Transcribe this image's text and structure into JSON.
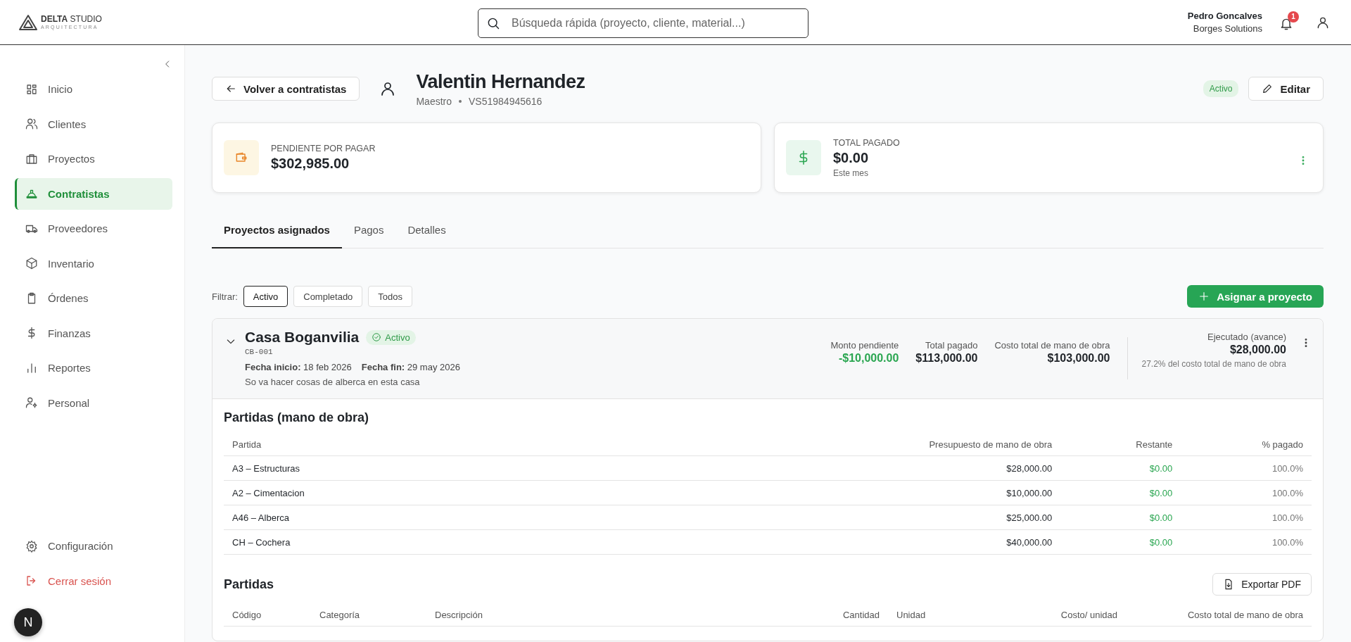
{
  "header": {
    "brand_bold": "DELTA",
    "brand_light": "STUDIO",
    "tagline": "ARQUITECTURA",
    "search": {
      "placeholder": "Búsqueda rápida (proyecto, cliente, material...)"
    },
    "user": {
      "name": "Pedro Goncalves",
      "company": "Borges Solutions"
    },
    "notification_count": "1"
  },
  "sidebar": {
    "items": [
      {
        "label": "Inicio",
        "selected": false
      },
      {
        "label": "Clientes",
        "selected": false
      },
      {
        "label": "Proyectos",
        "selected": false
      },
      {
        "label": "Contratistas",
        "selected": true
      },
      {
        "label": "Proveedores",
        "selected": false
      },
      {
        "label": "Inventario",
        "selected": false
      },
      {
        "label": "Órdenes",
        "selected": false
      },
      {
        "label": "Finanzas",
        "selected": false
      },
      {
        "label": "Reportes",
        "selected": false
      },
      {
        "label": "Personal",
        "selected": false
      }
    ],
    "footer_items": [
      {
        "label": "Configuración",
        "kind": "settings"
      },
      {
        "label": "Cerrar sesión",
        "kind": "logout"
      }
    ]
  },
  "dev_badge": "N",
  "contractor": {
    "back_button": "Volver a contratistas",
    "name": "Valentin Hernandez",
    "role": "Maestro",
    "code": "VS51984945616",
    "status": "Activo",
    "edit_button": "Editar"
  },
  "summary_cards": [
    {
      "kind": "pending",
      "label": "PENDIENTE POR PAGAR",
      "value": "$302,985.00"
    },
    {
      "kind": "paid",
      "label": "TOTAL PAGADO",
      "value": "$0.00",
      "note": "Este mes"
    }
  ],
  "tabs": [
    {
      "label": "Proyectos asignados",
      "selected": true
    },
    {
      "label": "Pagos",
      "selected": false
    },
    {
      "label": "Detalles",
      "selected": false
    }
  ],
  "filter": {
    "label": "Filtrar:",
    "options": [
      {
        "label": "Activo",
        "selected": true
      },
      {
        "label": "Completado",
        "selected": false
      },
      {
        "label": "Todos",
        "selected": false
      }
    ]
  },
  "assign_button": "Asignar a proyecto",
  "project": {
    "expanded": true,
    "name": "Casa Boganvilia",
    "status": "Activo",
    "code": "CB-001",
    "dates": [
      "**Fecha inicio:** 18 feb 2026",
      "**Fecha fin:** 29 may 2026"
    ],
    "description": "So va hacer cosas de alberca en esta casa",
    "metrics": [
      {
        "label": "Monto pendiente",
        "value": "-$10,000.00",
        "kind": "positive"
      },
      {
        "label": "Total pagado",
        "value": "$113,000.00",
        "kind": "normal"
      },
      {
        "label": "Costo total de mano de obra",
        "value": "$103,000.00",
        "kind": "normal"
      }
    ],
    "progress": {
      "label": "Ejecutado (avance)",
      "value": "$28,000.00",
      "note": "27.2% del costo total de mano de obra"
    },
    "labor_table": {
      "title": "Partidas (mano de obra)",
      "columns": [
        "Partida",
        "Presupuesto de mano de obra",
        "Restante",
        "% pagado"
      ],
      "rows": [
        [
          "A3 – Estructuras",
          "$28,000.00",
          "$0.00",
          "100.0%"
        ],
        [
          "A2 – Cimentacion",
          "$10,000.00",
          "$0.00",
          "100.0%"
        ],
        [
          "A46 – Alberca",
          "$25,000.00",
          "$0.00",
          "100.0%"
        ],
        [
          "CH – Cochera",
          "$40,000.00",
          "$0.00",
          "100.0%"
        ]
      ]
    },
    "items_table": {
      "title": "Partidas",
      "export_button": "Exportar PDF",
      "columns": [
        "Código",
        "Categoría",
        "Descripción",
        "Cantidad",
        "Unidad",
        "Costo/ unidad",
        "Costo total de mano de obra"
      ]
    }
  }
}
